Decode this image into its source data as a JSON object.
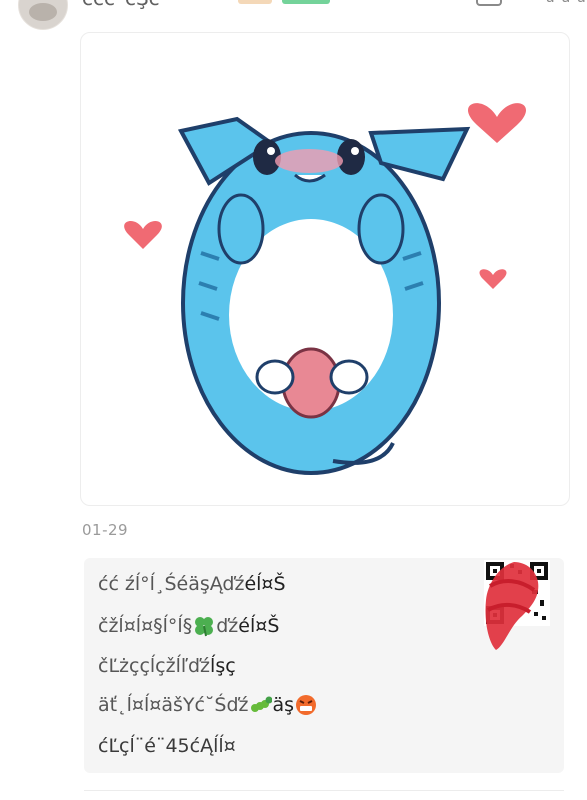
{
  "post": {
    "author": "ććć¨ćŞć",
    "date": "01-29"
  },
  "comments": [
    {
      "name": "ćć źĺ°ĺ¸Śé­äşĄďź",
      "text": "éĺ¤Š",
      "emoji_after_name": null,
      "emoji_after_text": null
    },
    {
      "name": "čžĺ¤ĺ¤§ĺ°ĺ§",
      "text": "éĺ¤Š",
      "emoji_after_name": "clover-icon",
      "emoji_after_text": null
    },
    {
      "name": "čĽżç­çĺçžĺľďź",
      "text": "ĺşç",
      "emoji_after_name": null,
      "emoji_after_text": null
    },
    {
      "name": "äť˛ĺ¤ĺ¤äšYć˘Śďź",
      "text": "äş",
      "emoji_before_text": "caterpillar-icon",
      "emoji_after_text": "angry-face-icon"
    }
  ],
  "view_all_label": "ćĽçĺ¨é¨45ćĄĺĺ¤",
  "colors": {
    "shark_body": "#5bc4ec",
    "heart": "#f06a73",
    "reply_bg": "#f5f5f5",
    "redaction": "#e0303c"
  }
}
